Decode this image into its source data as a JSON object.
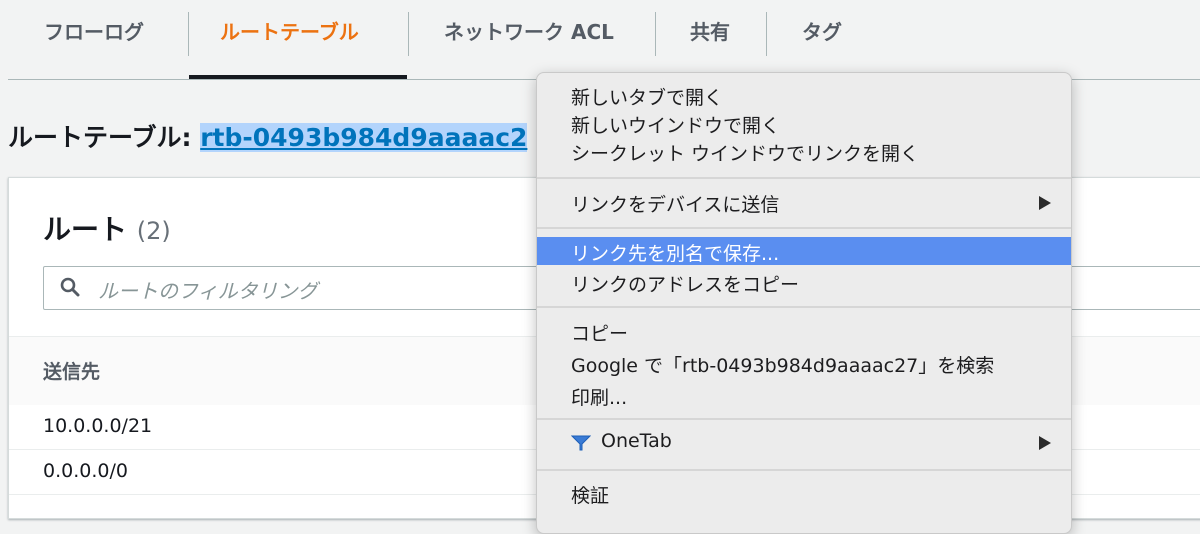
{
  "tabs": {
    "flow_logs": "フローログ",
    "route_table": "ルートテーブル",
    "network_acl": "ネットワーク ACL",
    "sharing": "共有",
    "tags": "タグ"
  },
  "heading": {
    "label": "ルートテーブル:",
    "link": "rtb-0493b984d9aaaac2"
  },
  "routes": {
    "title": "ルート",
    "count": "(2)",
    "search_placeholder": "ルートのフィルタリング",
    "column_destination": "送信先",
    "rows": [
      "10.0.0.0/21",
      "0.0.0.0/0"
    ]
  },
  "context_menu": {
    "open_new_tab": "新しいタブで開く",
    "open_new_window": "新しいウインドウで開く",
    "open_incognito": "シークレット ウインドウでリンクを開く",
    "send_to_device": "リンクをデバイスに送信",
    "save_link_as": "リンク先を別名で保存...",
    "copy_link_address": "リンクのアドレスをコピー",
    "copy": "コピー",
    "search_google": "Google で「rtb-0493b984d9aaaac27」を検索",
    "print": "印刷...",
    "onetab": "OneTab",
    "inspect": "検証"
  },
  "colors": {
    "active_tab": "#ec7211",
    "link": "#0073bb",
    "menu_highlight": "#5a8ef0"
  },
  "icons": {
    "search": "search-icon",
    "submenu": "chevron-right-icon",
    "onetab": "onetab-funnel-icon"
  }
}
